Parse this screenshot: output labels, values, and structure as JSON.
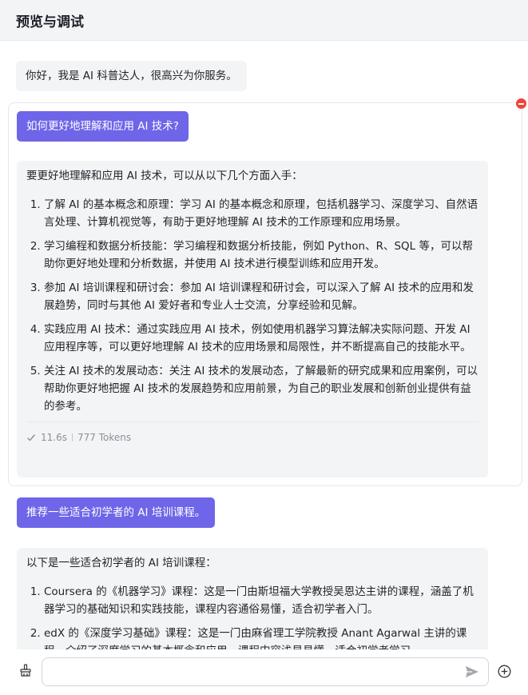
{
  "header": {
    "title": "预览与调试"
  },
  "chat": {
    "greeting": "你好，我是 AI 科普达人，很高兴为你服务。",
    "q1": "如何更好地理解和应用 AI 技术?",
    "a1_intro": "要更好地理解和应用 AI 技术，可以从以下几个方面入手：",
    "a1_items": [
      "了解 AI 的基本概念和原理：学习 AI 的基本概念和原理，包括机器学习、深度学习、自然语言处理、计算机视觉等，有助于更好地理解 AI 技术的工作原理和应用场景。",
      "学习编程和数据分析技能：学习编程和数据分析技能，例如 Python、R、SQL 等，可以帮助你更好地处理和分析数据，并使用 AI 技术进行模型训练和应用开发。",
      "参加 AI 培训课程和研讨会：参加 AI 培训课程和研讨会，可以深入了解 AI 技术的应用和发展趋势，同时与其他 AI 爱好者和专业人士交流，分享经验和见解。",
      "实践应用 AI 技术：通过实践应用 AI 技术，例如使用机器学习算法解决实际问题、开发 AI 应用程序等，可以更好地理解 AI 技术的应用场景和局限性，并不断提高自己的技能水平。",
      "关注 AI 技术的发展动态：关注 AI 技术的发展动态，了解最新的研究成果和应用案例，可以帮助你更好地把握 AI 技术的发展趋势和应用前景，为自己的职业发展和创新创业提供有益的参考。"
    ],
    "a1_time": "11.6s",
    "a1_tokens": "777 Tokens",
    "q2": "推荐一些适合初学者的 AI 培训课程。",
    "a2_intro": "以下是一些适合初学者的 AI 培训课程：",
    "a2_items": [
      "Coursera 的《机器学习》课程：这是一门由斯坦福大学教授吴恩达主讲的课程，涵盖了机器学习的基础知识和实践技能，课程内容通俗易懂，适合初学者入门。",
      "edX 的《深度学习基础》课程：这是一门由麻省理工学院教授 Anant Agarwal 主讲的课程，介绍了深度学习的基本概念和应用，课程内容浅显易懂，适合初学者学习。"
    ]
  },
  "input": {
    "value": "",
    "placeholder": ""
  },
  "icons": {
    "clear": "broom-icon",
    "remove": "remove-circle-icon",
    "send": "send-icon",
    "add": "add-circle-icon",
    "check": "check-icon"
  },
  "colors": {
    "accent": "#6e65e8",
    "bubble": "#f3f4f6",
    "danger": "#f0443a"
  }
}
